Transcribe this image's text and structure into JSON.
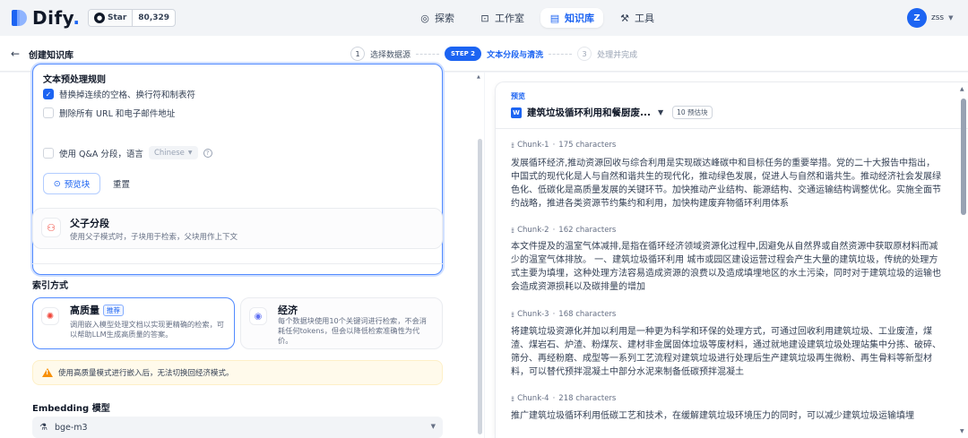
{
  "nav": {
    "logo_text": "Dify",
    "logo_suffix": ".",
    "star_label": "Star",
    "star_count": "80,329",
    "items": [
      {
        "label": "探索",
        "icon": "compass-icon",
        "active": false
      },
      {
        "label": "工作室",
        "icon": "robot-icon",
        "active": false
      },
      {
        "label": "知识库",
        "icon": "book-icon",
        "active": true
      },
      {
        "label": "工具",
        "icon": "wrench-icon",
        "active": false
      }
    ],
    "user_initial": "Z",
    "user_name": "zss"
  },
  "stepbar": {
    "title": "创建知识库",
    "steps": [
      {
        "num": "1",
        "label": "选择数据源",
        "state": "done"
      },
      {
        "num": "STEP 2",
        "label": "文本分段与清洗",
        "state": "current"
      },
      {
        "num": "3",
        "label": "处理并完成",
        "state": "future"
      }
    ]
  },
  "rules": {
    "title": "文本预处理规则",
    "options": [
      {
        "label": "替换掉连续的空格、换行符和制表符",
        "checked": true
      },
      {
        "label": "删除所有 URL 和电子邮件地址",
        "checked": false
      }
    ],
    "qa_label": "使用 Q&A 分段，语言",
    "qa_checked": false,
    "qa_language": "Chinese",
    "preview_btn": "预览块",
    "reset_btn": "重置"
  },
  "parent_child": {
    "title": "父子分段",
    "desc": "使用父子模式时，子块用于检索，父块用作上下文"
  },
  "index": {
    "section_title": "索引方式",
    "high_quality": {
      "title": "高质量",
      "badge": "推荐",
      "desc": "调用嵌入模型处理文档以实现更精确的检索，可以帮助LLM生成高质量的答案。"
    },
    "economy": {
      "title": "经济",
      "desc": "每个数据块使用10个关键词进行检索，不会消耗任何tokens，但会以降低检索准确性为代价。"
    },
    "warning": "使用高质量模式进行嵌入后，无法切换回经济模式。"
  },
  "embedding": {
    "title": "Embedding 模型",
    "value": "bge-m3"
  },
  "preview": {
    "label": "预览",
    "file_name": "建筑垃圾循环利用和餐厨废...",
    "count_badge": "10 预估块",
    "chunks": [
      {
        "title": "Chunk-1",
        "chars": "175 characters",
        "text": "发展循环经济,推动资源回收与综合利用是实现碳达峰碳中和目标任务的重要举措。党的二十大报告中指出，中国式的现代化是人与自然和谐共生的现代化，推动绿色发展，促进人与自然和谐共生。推动经济社会发展绿色化、低碳化是高质量发展的关键环节。加快推动产业结构、能源结构、交通运输结构调整优化。实施全面节约战略，推进各类资源节约集约和利用，加快构建废弃物循环利用体系"
      },
      {
        "title": "Chunk-2",
        "chars": "162 characters",
        "text": "本文件提及的温室气体减排,是指在循环经济领域资源化过程中,因避免从自然界或自然资源中获取原材料而减少的温室气体排放。 一、建筑垃圾循环利用 城市或园区建设运营过程会产生大量的建筑垃圾，传统的处理方式主要为填埋，这种处理方法容易造成资源的浪费以及造成填埋地区的水土污染，同时对于建筑垃圾的运输也会造成资源损耗以及碳排量的增加"
      },
      {
        "title": "Chunk-3",
        "chars": "168 characters",
        "text": "将建筑垃圾资源化并加以利用是一种更为科学和环保的处理方式，可通过回收利用建筑垃圾、工业废渣，煤渣、煤岩石、炉渣、粉煤灰、建材非金属固体垃圾等废材料，通过就地建设建筑垃圾处理站集中分拣、破碎、筛分、再经粉磨、成型等一系列工艺流程对建筑垃圾进行处理后生产建筑垃圾再生微粉、再生骨料等新型材料，可以替代预拌混凝土中部分水泥来制备低碳预拌混凝土"
      },
      {
        "title": "Chunk-4",
        "chars": "218 characters",
        "text": "推广建筑垃圾循环利用低碳工艺和技术，在缓解建筑垃圾环境压力的同时，可以减少建筑垃圾运输填埋"
      }
    ]
  },
  "colors": {
    "accent": "#1c64f2",
    "warning": "#f79009",
    "text": "#344054"
  }
}
